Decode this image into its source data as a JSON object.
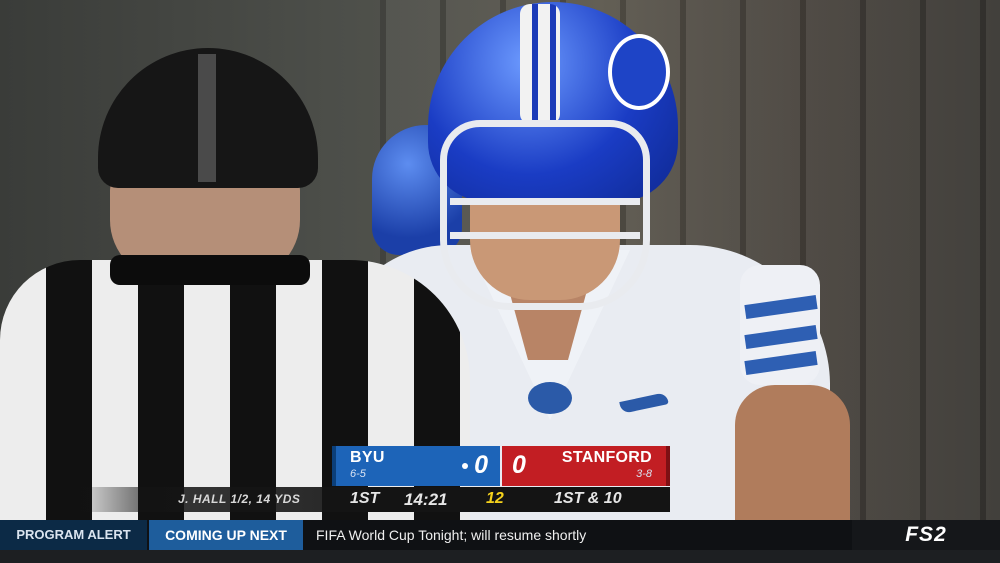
{
  "scorebug": {
    "away": {
      "name": "BYU",
      "record": "6-5",
      "score": "0",
      "color": "#1d64b8"
    },
    "home": {
      "name": "STANFORD",
      "record": "3-8",
      "score": "0",
      "color": "#c21e23"
    },
    "quarter": "1ST",
    "clock": "14:21",
    "play_clock": "12",
    "down_distance": "1ST & 10",
    "player_stat": "J. HALL 1/2, 14 YDS"
  },
  "ticker": {
    "alert_label": "PROGRAM ALERT",
    "coming_up_label": "COMING UP NEXT",
    "message": "FIFA World Cup Tonight; will resume shortly",
    "network": "FS2"
  }
}
